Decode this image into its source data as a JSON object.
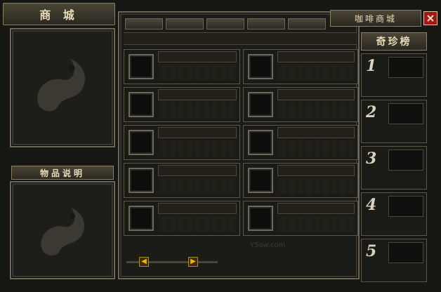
{
  "window": {
    "title": "商 城"
  },
  "shop_header": {
    "title": "咖啡商城"
  },
  "item_desc": {
    "label": "物品说明"
  },
  "ranking": {
    "title": "奇珍榜",
    "entries": [
      "1",
      "2",
      "3",
      "4",
      "5"
    ]
  },
  "category_tabs": [
    "",
    "",
    "",
    "",
    ""
  ],
  "watermark": "Y5ow.com",
  "icons": {
    "close": "close-icon",
    "prev": "arrow-left-icon",
    "next": "arrow-right-icon",
    "dragon": "dragon-emblem-icon"
  },
  "colors": {
    "frame": "#6e6858",
    "background": "#161613",
    "text": "#e8dcb8",
    "close": "#a01818",
    "arrow": "#ffb000"
  }
}
